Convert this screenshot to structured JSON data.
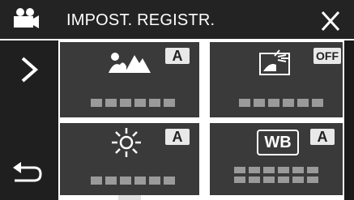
{
  "header": {
    "title": "IMPOST. REGISTR.",
    "mode_icon": "video-camera-icon",
    "close_icon": "close-icon"
  },
  "nav": {
    "next_icon": "chevron-right-icon",
    "back_icon": "return-arrow-icon"
  },
  "tiles": [
    {
      "icon": "scene-mountains-icon",
      "badge": "A"
    },
    {
      "icon": "backlight-compensation-icon",
      "badge": "OFF"
    },
    {
      "icon": "brightness-sun-icon",
      "badge": "A"
    },
    {
      "icon": "white-balance-icon",
      "icon_text": "WB",
      "badge": "A"
    }
  ],
  "colors": {
    "header_bg": "#232323",
    "tile_bg": "#3a3a3a",
    "placeholder": "#9a9a9a",
    "badge_bg": "#e8e8e8"
  }
}
